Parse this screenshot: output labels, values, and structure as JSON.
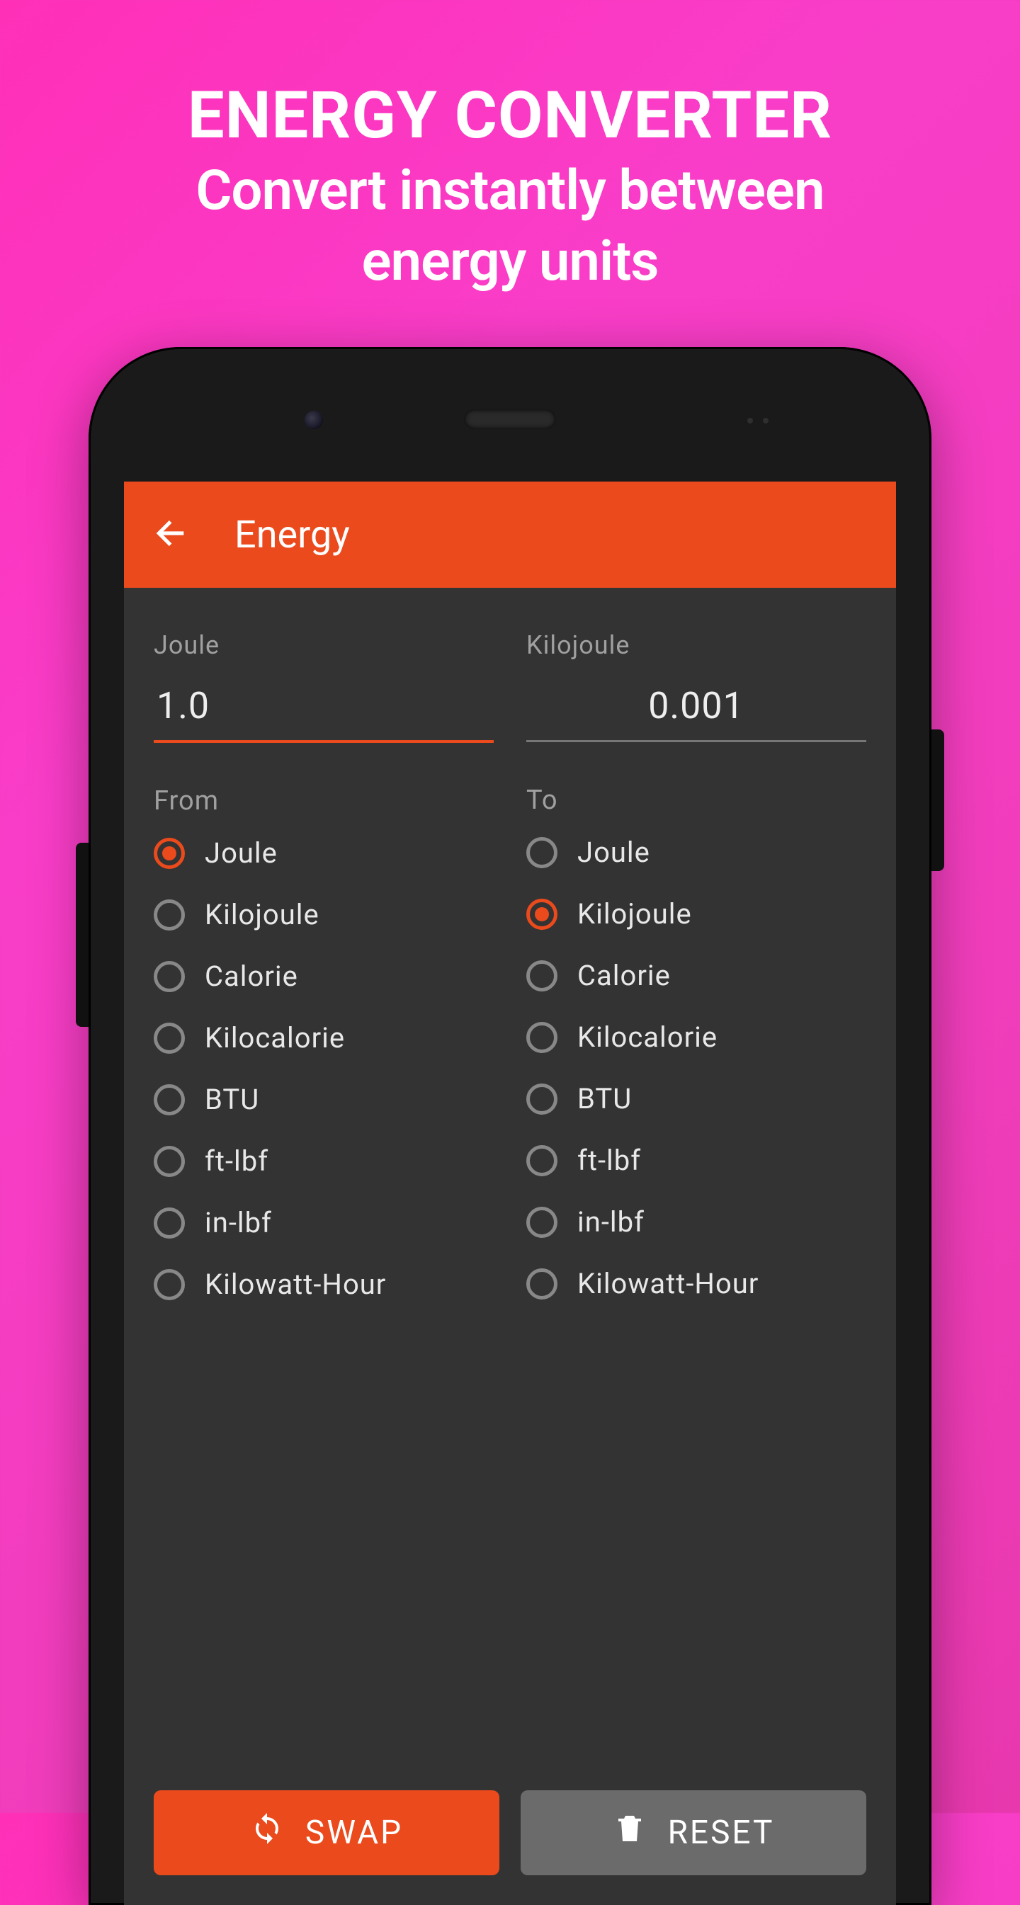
{
  "promo": {
    "title": "ENERGY CONVERTER",
    "sub1": "Convert instantly between",
    "sub2": "energy units"
  },
  "appbar": {
    "title": "Energy"
  },
  "left": {
    "unit": "Joule",
    "value": "1.0",
    "section": "From",
    "selected": 0
  },
  "right": {
    "unit": "Kilojoule",
    "value": "0.001",
    "section": "To",
    "selected": 1
  },
  "units": [
    "Joule",
    "Kilojoule",
    "Calorie",
    "Kilocalorie",
    "BTU",
    "ft-lbf",
    "in-lbf",
    "Kilowatt-Hour"
  ],
  "buttons": {
    "swap": "SWAP",
    "reset": "RESET"
  }
}
